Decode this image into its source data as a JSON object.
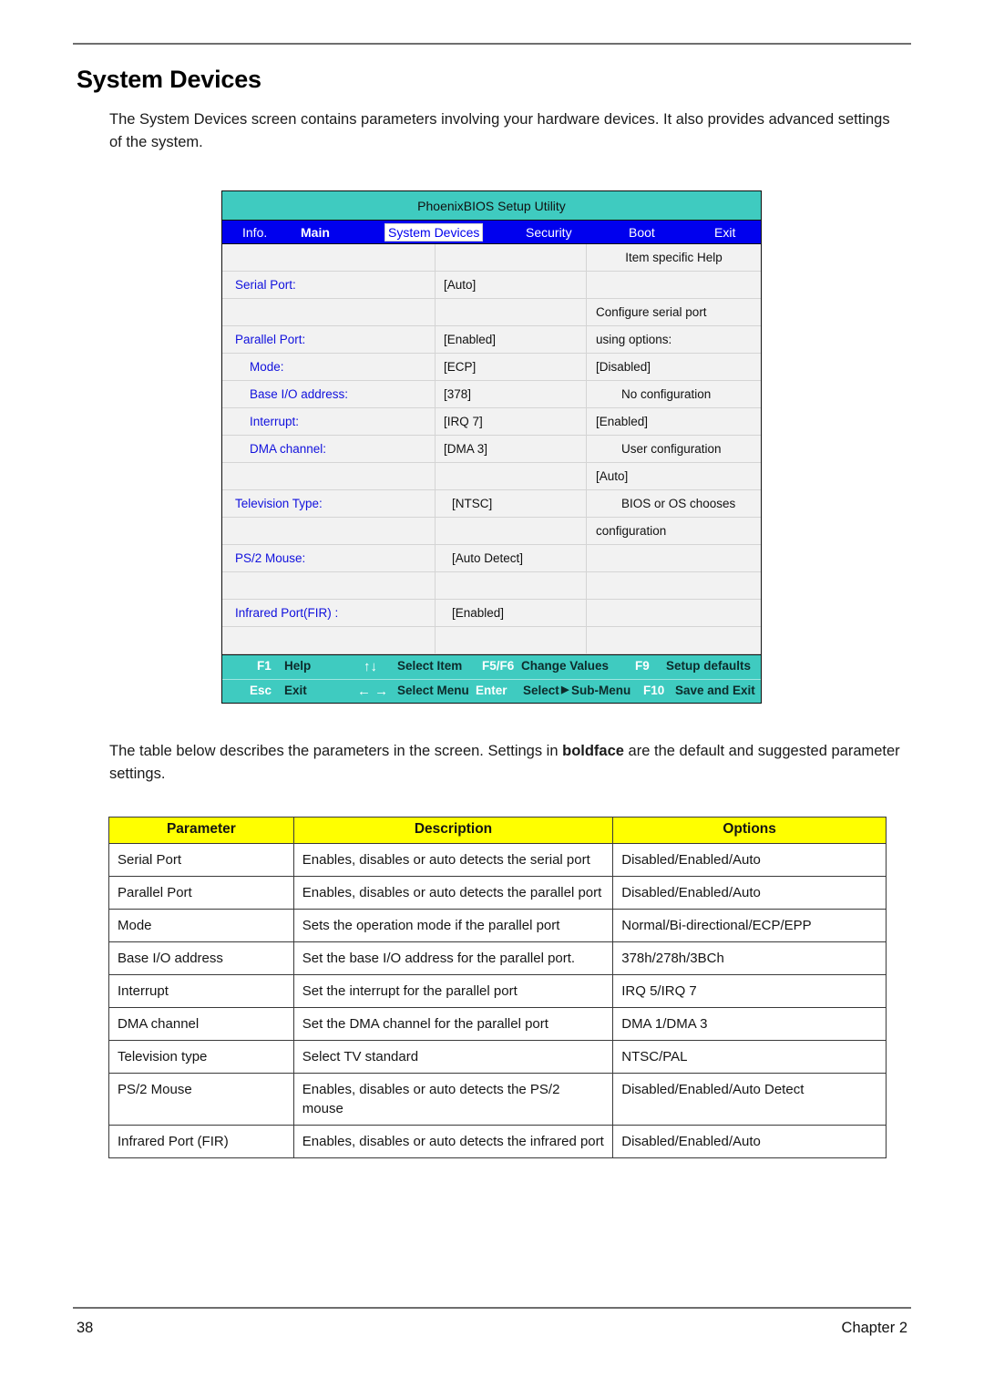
{
  "page": {
    "title": "System Devices",
    "intro": "The System Devices screen contains parameters involving your hardware devices. It also provides advanced settings of the system.",
    "mid_text_before": "The table below describes the parameters in the screen. Settings in ",
    "mid_text_bold": "boldface",
    "mid_text_after": " are the default and suggested parameter settings.",
    "page_number": "38",
    "chapter": "Chapter 2"
  },
  "bios": {
    "title": "PhoenixBIOS Setup Utility",
    "menu": {
      "info": "Info.",
      "main": "Main",
      "system_devices": "System Devices",
      "security": "Security",
      "boot": "Boot",
      "exit": "Exit",
      "active": "System Devices"
    },
    "help_panel": {
      "heading": "Item specific Help",
      "lines": [
        "Configure serial port",
        "using options:",
        "[Disabled]",
        "No configuration",
        "[Enabled]",
        "User configuration",
        "[Auto]",
        "BIOS or OS chooses",
        "configuration"
      ]
    },
    "settings": [
      {
        "label": "Serial Port:",
        "value": "[Auto]",
        "indent": false
      },
      {
        "label": "",
        "value": "",
        "indent": false
      },
      {
        "label": "Parallel Port:",
        "value": "[Enabled]",
        "indent": false
      },
      {
        "label": "Mode:",
        "value": "[ECP]",
        "indent": true
      },
      {
        "label": "Base I/O address:",
        "value": "[378]",
        "indent": true
      },
      {
        "label": "Interrupt:",
        "value": "[IRQ 7]",
        "indent": true
      },
      {
        "label": "DMA channel:",
        "value": "[DMA 3]",
        "indent": true
      },
      {
        "label": "",
        "value": "",
        "indent": false
      },
      {
        "label": "Television Type:",
        "value": "[NTSC]",
        "indent": false
      },
      {
        "label": "",
        "value": "",
        "indent": false
      },
      {
        "label": "PS/2 Mouse:",
        "value": "[Auto Detect]",
        "indent": false
      },
      {
        "label": "",
        "value": "",
        "indent": false
      },
      {
        "label": "Infrared Port(FIR) :",
        "value": "[Enabled]",
        "indent": false
      },
      {
        "label": "",
        "value": "",
        "indent": false
      }
    ],
    "footer": {
      "row1": [
        {
          "key": "F1",
          "label": "Help"
        },
        {
          "key": "↑↓",
          "label": "Select Item"
        },
        {
          "key": "F5/F6",
          "label": "Change Values"
        },
        {
          "key": "F9",
          "label": "Setup defaults"
        }
      ],
      "row2": [
        {
          "key": "Esc",
          "label": "Exit"
        },
        {
          "key": "← →",
          "label": "Select Menu"
        },
        {
          "key": "Enter",
          "label": "Select"
        },
        {
          "key": "",
          "label": "Sub-Menu"
        },
        {
          "key": "F10",
          "label": "Save and Exit"
        }
      ],
      "f1": "F1",
      "help": "Help",
      "updown": "↑↓",
      "select_item": "Select Item",
      "f5f6": "F5/F6",
      "change_values": "Change Values",
      "f9": "F9",
      "setup_defaults": "Setup defaults",
      "esc": "Esc",
      "exit": "Exit",
      "leftright": "← →",
      "select_menu": "Select Menu",
      "enter": "Enter",
      "select": "Select",
      "triangle": "▶",
      "sub_menu": "Sub-Menu",
      "f10": "F10",
      "save_and_exit": "Save and Exit"
    },
    "colors": {
      "titlebar": "#3fcbc0",
      "menubar": "#0000ee",
      "label_text": "#1111dd",
      "footer": "#3fcbc0"
    }
  },
  "param_table": {
    "headers": [
      "Parameter",
      "Description",
      "Options"
    ],
    "header_bg": "#ffff00",
    "rows": [
      {
        "parameter": "Serial Port",
        "description": "Enables, disables or auto detects the serial port",
        "options": "Disabled/Enabled/Auto"
      },
      {
        "parameter": "Parallel Port",
        "description": "Enables, disables or auto detects the parallel port",
        "options": "Disabled/Enabled/Auto"
      },
      {
        "parameter": "Mode",
        "description": "Sets the operation mode if the parallel port",
        "options": "Normal/Bi-directional/ECP/EPP"
      },
      {
        "parameter": "Base I/O address",
        "description": "Set the base I/O address for the parallel port.",
        "options": "378h/278h/3BCh"
      },
      {
        "parameter": "Interrupt",
        "description": "Set the interrupt for the parallel port",
        "options": "IRQ 5/IRQ 7"
      },
      {
        "parameter": "DMA channel",
        "description": "Set the DMA channel for the parallel port",
        "options": "DMA 1/DMA 3"
      },
      {
        "parameter": "Television type",
        "description": "Select TV standard",
        "options": "NTSC/PAL"
      },
      {
        "parameter": "PS/2 Mouse",
        "description": "Enables, disables or auto detects the PS/2 mouse",
        "options": "Disabled/Enabled/Auto Detect"
      },
      {
        "parameter": "Infrared Port (FIR)",
        "description": "Enables, disables or auto detects the infrared port",
        "options": "Disabled/Enabled/Auto"
      }
    ]
  }
}
